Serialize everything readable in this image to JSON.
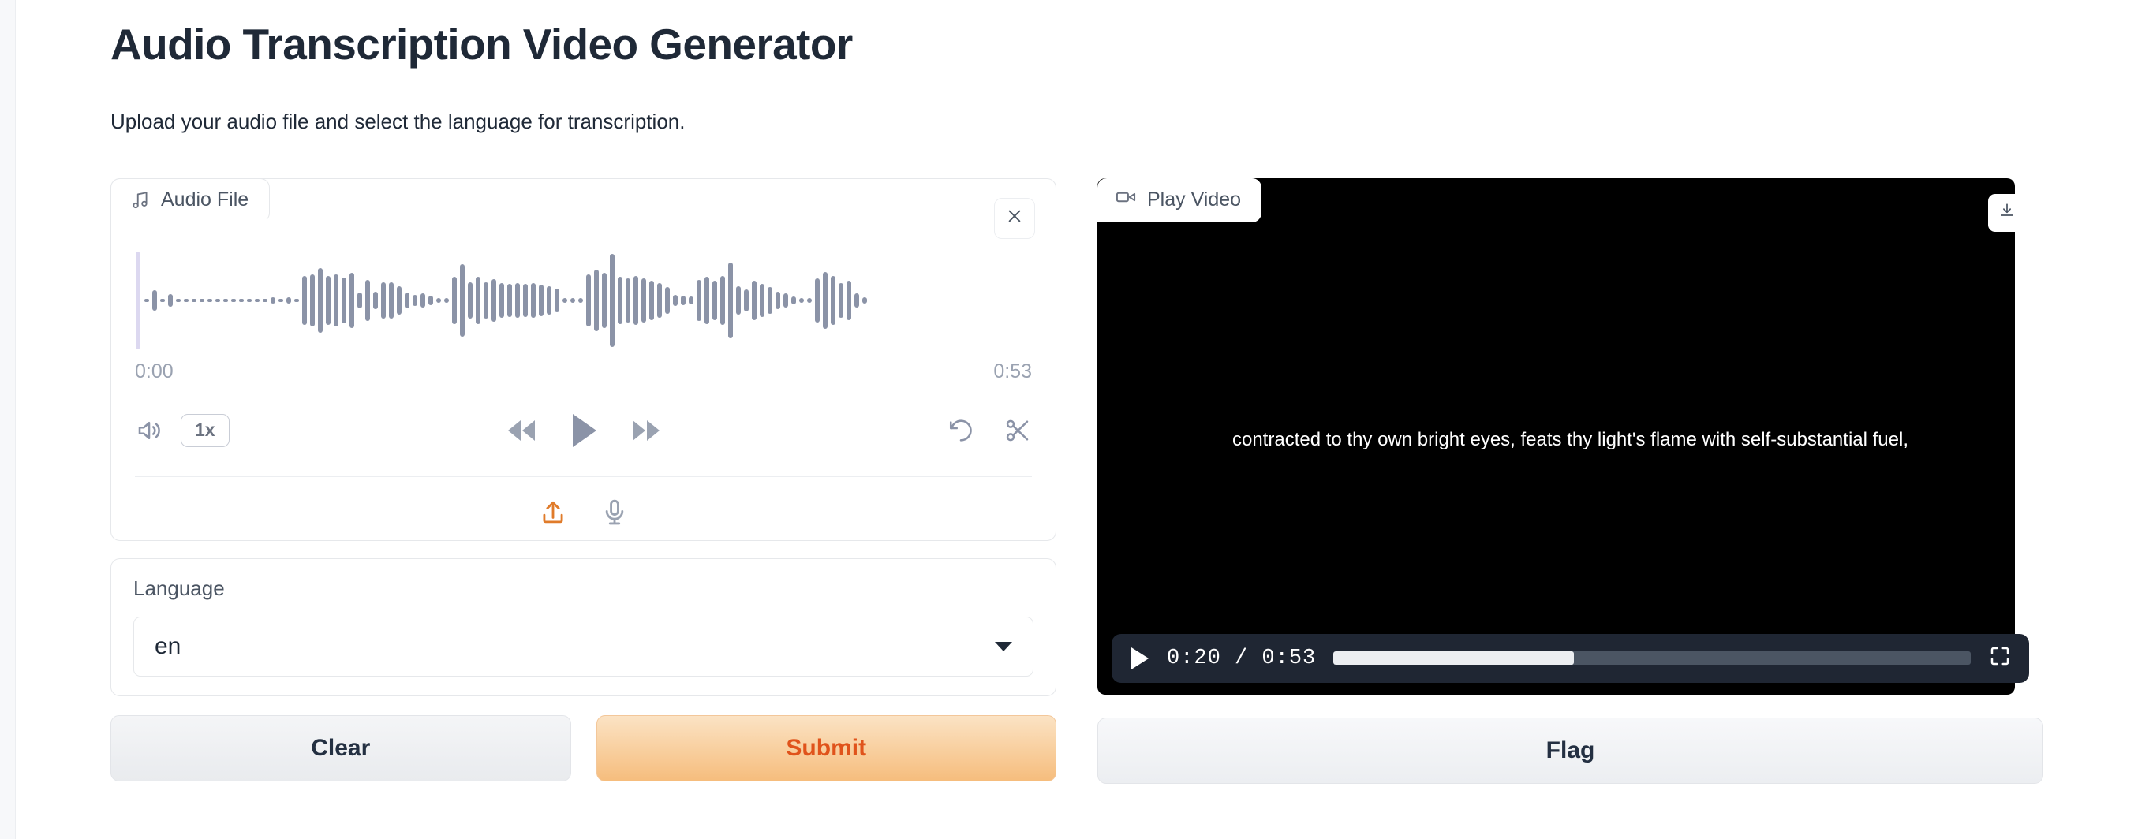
{
  "header": {
    "title": "Audio Transcription Video Generator",
    "subtitle": "Upload your audio file and select the language for transcription."
  },
  "audio_panel": {
    "tab_label": "Audio File",
    "tab_icon": "music-note-icon",
    "close_icon": "close-icon",
    "start_time": "0:00",
    "end_time": "0:53",
    "volume_icon": "volume-icon",
    "speed_label": "1x",
    "rewind_icon": "rewind-icon",
    "play_icon": "play-icon",
    "forward_icon": "fast-forward-icon",
    "reset_icon": "undo-icon",
    "trim_icon": "scissors-icon",
    "upload_icon": "upload-icon",
    "mic_icon": "microphone-icon",
    "waveform": {
      "bar_color": "#8b93a7",
      "playhead_color": "#dcd8f0",
      "amplitudes": [
        4,
        26,
        4,
        16,
        4,
        4,
        4,
        4,
        4,
        4,
        4,
        4,
        4,
        4,
        4,
        4,
        8,
        4,
        8,
        4,
        62,
        66,
        82,
        62,
        66,
        58,
        70,
        20,
        52,
        22,
        46,
        46,
        36,
        20,
        14,
        18,
        12,
        6,
        6,
        60,
        92,
        46,
        60,
        46,
        54,
        44,
        42,
        44,
        42,
        44,
        40,
        36,
        30,
        6,
        6,
        6,
        66,
        78,
        70,
        118,
        60,
        56,
        62,
        56,
        50,
        44,
        34,
        14,
        12,
        10,
        52,
        60,
        50,
        62,
        96,
        36,
        28,
        50,
        42,
        34,
        22,
        18,
        10,
        6,
        6,
        56,
        72,
        62,
        44,
        50,
        18,
        8
      ]
    }
  },
  "language_panel": {
    "label": "Language",
    "selected_value": "en",
    "caret_icon": "chevron-down-icon"
  },
  "actions": {
    "clear_label": "Clear",
    "submit_label": "Submit",
    "submit_accent": "#e0531b"
  },
  "video_panel": {
    "tab_label": "Play Video",
    "tab_icon": "video-camera-icon",
    "download_icon": "download-icon",
    "subtitle_text": "contracted to thy own bright eyes, feats thy light's flame with self-substantial fuel,",
    "play_icon": "play-icon",
    "time_display": "0:20 / 0:53",
    "current_time": "0:20",
    "total_time": "0:53",
    "progress_percent": 37.7,
    "fullscreen_icon": "fullscreen-icon",
    "flag_label": "Flag"
  }
}
